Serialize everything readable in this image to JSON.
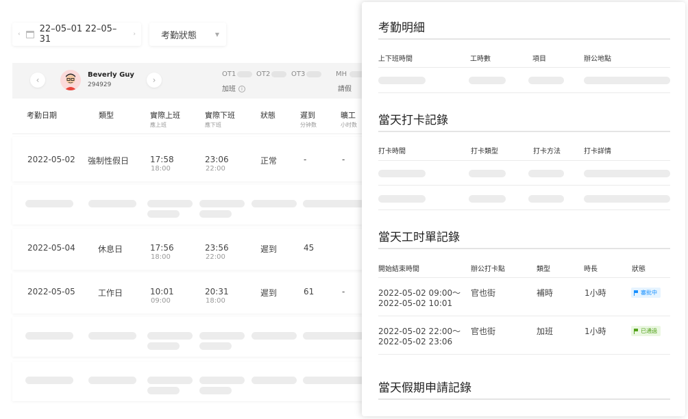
{
  "filter": {
    "date_range": "22–05–01 22–05–31",
    "status_placeholder": "考勤狀態"
  },
  "employee": {
    "name": "Beverly Guy",
    "id": "294929",
    "ot_labels": [
      "OT1",
      "OT2",
      "OT3",
      "MH"
    ],
    "overtime_label": "加班",
    "leave_label": "請假"
  },
  "table": {
    "headers": [
      {
        "label": "考勤日期",
        "sub": ""
      },
      {
        "label": "類型",
        "sub": ""
      },
      {
        "label": "實際上班",
        "sub": "應上班"
      },
      {
        "label": "實際下班",
        "sub": "應下班"
      },
      {
        "label": "狀態",
        "sub": ""
      },
      {
        "label": "遲到",
        "sub": "分钟数"
      },
      {
        "label": "曠工",
        "sub": "小时数"
      }
    ],
    "rows": [
      {
        "date": "2022-05-02",
        "type": "強制性假日",
        "in": "17:58",
        "in_sched": "18:00",
        "out": "23:06",
        "out_sched": "22:00",
        "status": "正常",
        "late": "-",
        "absent": "-"
      },
      {
        "date": "2022-05-04",
        "type": "休息日",
        "in": "17:56",
        "in_sched": "18:00",
        "out": "23:56",
        "out_sched": "22:00",
        "status": "遲到",
        "late": "45",
        "absent": "-"
      },
      {
        "date": "2022-05-05",
        "type": "工作日",
        "in": "10:01",
        "in_sched": "09:00",
        "out": "20:31",
        "out_sched": "18:00",
        "status": "遲到",
        "late": "61",
        "absent": "-"
      }
    ]
  },
  "panel": {
    "detail": {
      "title": "考勤明細",
      "headers": [
        "上下班時間",
        "工時數",
        "項目",
        "辦公地點"
      ]
    },
    "punch": {
      "title": "當天打卡記錄",
      "headers": [
        "打卡時間",
        "打卡類型",
        "打卡方法",
        "打卡詳情"
      ]
    },
    "timesheet": {
      "title": "當天工时單記錄",
      "headers": [
        "開始結束時間",
        "辦公打卡點",
        "類型",
        "時長",
        "狀態"
      ],
      "rows": [
        {
          "start": "2022-05-02 09:00～",
          "end": "2022-05-02 10:01",
          "location": "官也街",
          "type": "補時",
          "duration": "1小時",
          "status": "審批中"
        },
        {
          "start": "2022-05-02 22:00～",
          "end": "2022-05-02 23:06",
          "location": "官也街",
          "type": "加班",
          "duration": "1小時",
          "status": "已通過"
        }
      ]
    },
    "leave": {
      "title": "當天假期申請記錄"
    }
  },
  "colors": {
    "pending": "#1890ff",
    "approved": "#52a21a"
  }
}
